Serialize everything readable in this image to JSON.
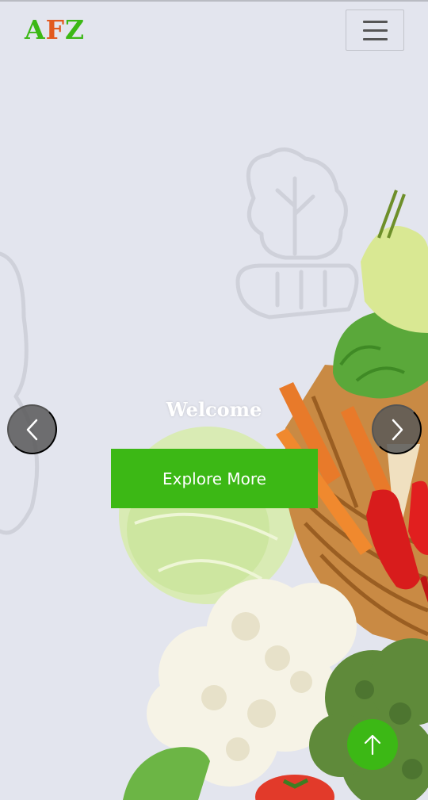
{
  "header": {
    "logo": {
      "part1": "A",
      "part2": "F",
      "part3": "Z"
    },
    "menu_icon": "hamburger-menu-icon"
  },
  "hero": {
    "title": "Welcome",
    "cta_label": "Explore More",
    "prev_icon": "chevron-left-icon",
    "next_icon": "chevron-right-icon"
  },
  "back_to_top_icon": "arrow-up-icon",
  "colors": {
    "brand_green": "#3cb815",
    "brand_orange": "#e2591e",
    "background": "#e3e5ee"
  }
}
